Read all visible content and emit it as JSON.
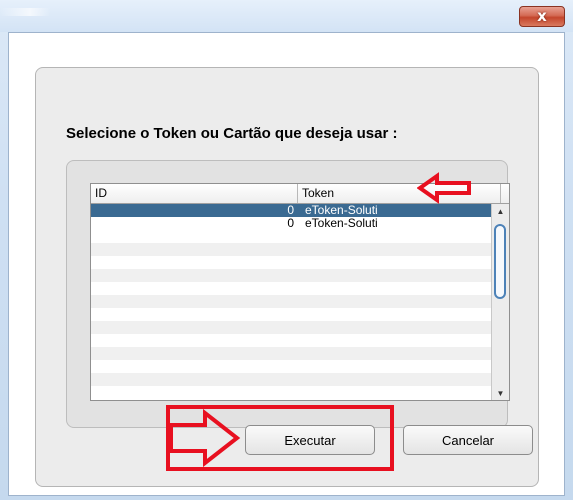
{
  "window": {
    "close_glyph": "x"
  },
  "dialog": {
    "title": "Selecione o Token ou Cartão que deseja usar :"
  },
  "table": {
    "columns": [
      "ID",
      "Token"
    ],
    "rows": [
      {
        "id": "0",
        "token": "eToken-Soluti",
        "selected": true
      },
      {
        "id": "0",
        "token": "eToken-Soluti",
        "selected": false
      }
    ],
    "scroll_up_glyph": "▲",
    "scroll_down_glyph": "▼"
  },
  "buttons": {
    "execute_label": "Executar",
    "cancel_label": "Cancelar"
  },
  "colors": {
    "selection": "#3a6a92",
    "annotation": "#e81020",
    "scroll_thumb": "#4d82b8"
  }
}
